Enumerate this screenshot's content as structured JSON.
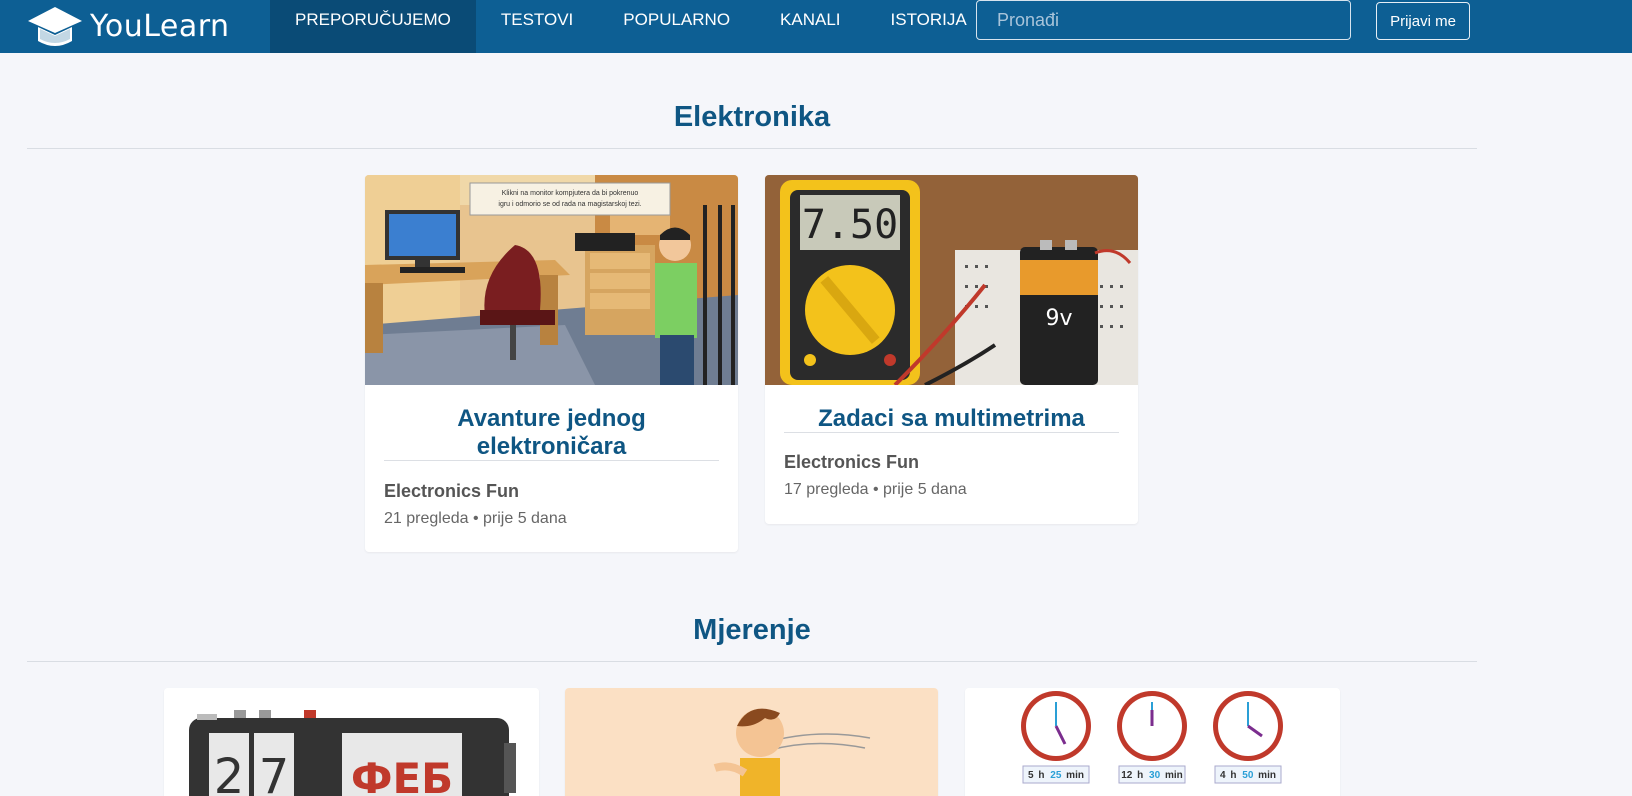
{
  "header": {
    "logo_text": "YouLearn",
    "nav": [
      "PREPORUČUJEMO",
      "TESTOVI",
      "POPULARNO",
      "KANALI",
      "ISTORIJA"
    ],
    "active_index": 0,
    "search_placeholder": "Pronađi",
    "login_label": "Prijavi me"
  },
  "sections": [
    {
      "title": "Elektronika",
      "cards": [
        {
          "title": "Avanture jednog elektroničara",
          "channel": "Electronics Fun",
          "meta": "21 pregleda • prije 5 dana",
          "image_text": "Klikni na monitor kompjutera da bi pokrenuo igru i odmorio se od rada na magistarskoj tezi."
        },
        {
          "title": "Zadaci sa multimetrima",
          "channel": "Electronics Fun",
          "meta": "17 pregleda • prije 5 dana",
          "image_display": "7.50",
          "image_battery": "9v"
        }
      ]
    },
    {
      "title": "Mjerenje",
      "cards": [
        {
          "image_digits": [
            "2",
            "7"
          ],
          "image_month": "ФЕБ"
        },
        {},
        {
          "clocks": [
            {
              "hours": "5",
              "minutes": "25",
              "h_label": "h",
              "min_label": "min"
            },
            {
              "hours": "12",
              "minutes": "30",
              "h_label": "h",
              "min_label": "min"
            },
            {
              "hours": "4",
              "minutes": "50",
              "h_label": "h",
              "min_label": "min"
            }
          ]
        }
      ]
    }
  ],
  "colors": {
    "navbar": "#0d5f94",
    "nav_active": "#0a4b76",
    "title_blue": "#0f5683",
    "background": "#f5f6fa"
  }
}
